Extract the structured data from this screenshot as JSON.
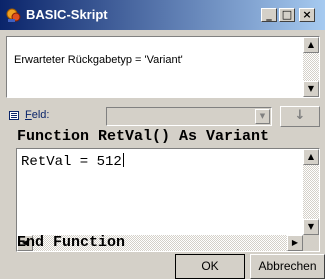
{
  "window": {
    "title": "BASIC-Skript",
    "controls": {
      "minimize": "_",
      "maximize": "□",
      "close": "×"
    }
  },
  "description": {
    "text": "Erwarteter Rückgabetyp = 'Variant'"
  },
  "field": {
    "label_mnemonic": "F",
    "label_rest": "eld:",
    "value": "",
    "insert_icon": "arrow-down-icon"
  },
  "code": {
    "header": "Function RetVal() As Variant",
    "body": "RetVal = 512",
    "footer": "End Function"
  },
  "buttons": {
    "ok": "OK",
    "cancel": "Abbrechen"
  }
}
